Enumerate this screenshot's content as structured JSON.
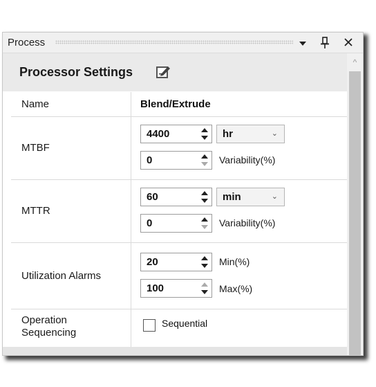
{
  "window": {
    "title": "Process",
    "menu_glyph": "▾",
    "pin_glyph": "⊥",
    "close_glyph": "✕"
  },
  "header": {
    "title": "Processor Settings",
    "edit_icon": "edit-icon"
  },
  "rows": {
    "name": {
      "label": "Name",
      "value": "Blend/Extrude"
    },
    "mtbf": {
      "label": "MTBF",
      "value": "4400",
      "unit": "hr",
      "variability": "0",
      "variability_label": "Variability(%)"
    },
    "mttr": {
      "label": "MTTR",
      "value": "60",
      "unit": "min",
      "variability": "0",
      "variability_label": "Variability(%)"
    },
    "alarms": {
      "label": "Utilization Alarms",
      "min": "20",
      "min_label": "Min(%)",
      "max": "100",
      "max_label": "Max(%)"
    },
    "sequencing": {
      "label_line1": "Operation",
      "label_line2": "Sequencing",
      "checkbox_label": "Sequential",
      "checked": false
    }
  },
  "scrollbar": {
    "up_glyph": "^"
  }
}
